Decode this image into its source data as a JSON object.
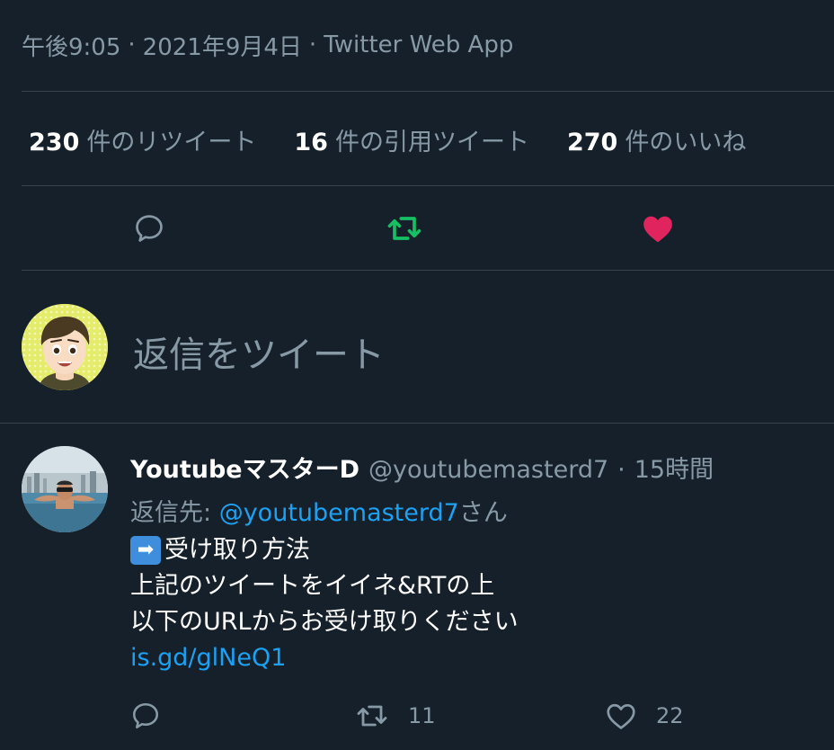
{
  "tweet_meta": {
    "time": "午後9:05",
    "separator_1": "·",
    "date": "2021年9月4日",
    "separator_2": "·",
    "source": "Twitter Web App"
  },
  "stats": {
    "retweets_count": "230",
    "retweets_label": "件のリツイート",
    "quotes_count": "16",
    "quotes_label": "件の引用ツイート",
    "likes_count": "270",
    "likes_label": "件のいいね"
  },
  "actions": {
    "reply_icon": "reply-icon",
    "retweet_icon": "retweet-icon",
    "like_icon": "heart-filled-icon",
    "retweet_color": "#17bf63",
    "like_color": "#e0245e"
  },
  "compose": {
    "placeholder": "返信をツイート"
  },
  "reply": {
    "display_name": "YoutubeマスターD",
    "handle": "@youtubemasterd7",
    "dot": "·",
    "time_ago": "15時間",
    "replying_to_prefix": "返信先:",
    "replying_to_handle": "@youtubemasterd7",
    "replying_to_suffix": "さん",
    "body": {
      "emoji": "➡",
      "line1": "受け取り方法",
      "line2": "上記のツイートをイイネ&RTの上",
      "line3": "以下のURLからお受け取りください",
      "link": "is.gd/glNeQ1"
    },
    "actions": {
      "reply_count": "",
      "retweet_count": "11",
      "like_count": "22"
    }
  },
  "colors": {
    "background": "#15202b",
    "border": "#38444d",
    "secondary_text": "#8899a6",
    "link": "#1da1f2"
  }
}
